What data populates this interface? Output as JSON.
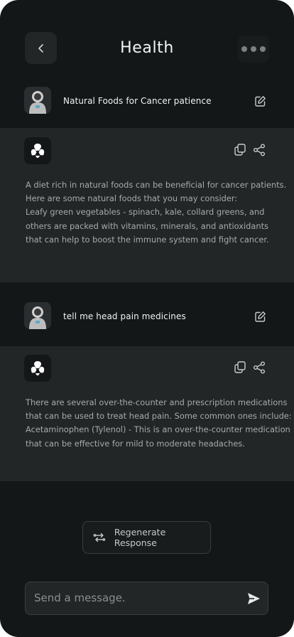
{
  "header": {
    "title": "Health",
    "back_icon": "chevron-left-icon",
    "more_icon": "more-horizontal-icon"
  },
  "conversation": [
    {
      "prompt": "Natural Foods for Cancer patience",
      "answer_lines": [
        "A diet rich in natural foods can be beneficial for cancer patients.",
        "Here are some natural foods that you may consider:",
        "Leafy green vegetables - spinach, kale, collard greens, and",
        "others are packed with vitamins, minerals, and antioxidants",
        "that can help to boost the immune system and fight cancer."
      ]
    },
    {
      "prompt": "tell me head pain medicines",
      "answer_lines": [
        "There are several over-the-counter and prescription medications",
        "that can be used to treat head pain. Some common ones include:",
        "Acetaminophen (Tylenol) - This is an over-the-counter medication",
        "that can be effective for mild to moderate headaches."
      ]
    }
  ],
  "actions": {
    "regenerate_label": "Regenerate Response"
  },
  "composer": {
    "placeholder": "Send a message.",
    "value": ""
  },
  "colors": {
    "background": "#141718",
    "answer_background": "#232627",
    "text_primary": "#f3f4f4",
    "text_secondary": "#a7a9aa"
  }
}
